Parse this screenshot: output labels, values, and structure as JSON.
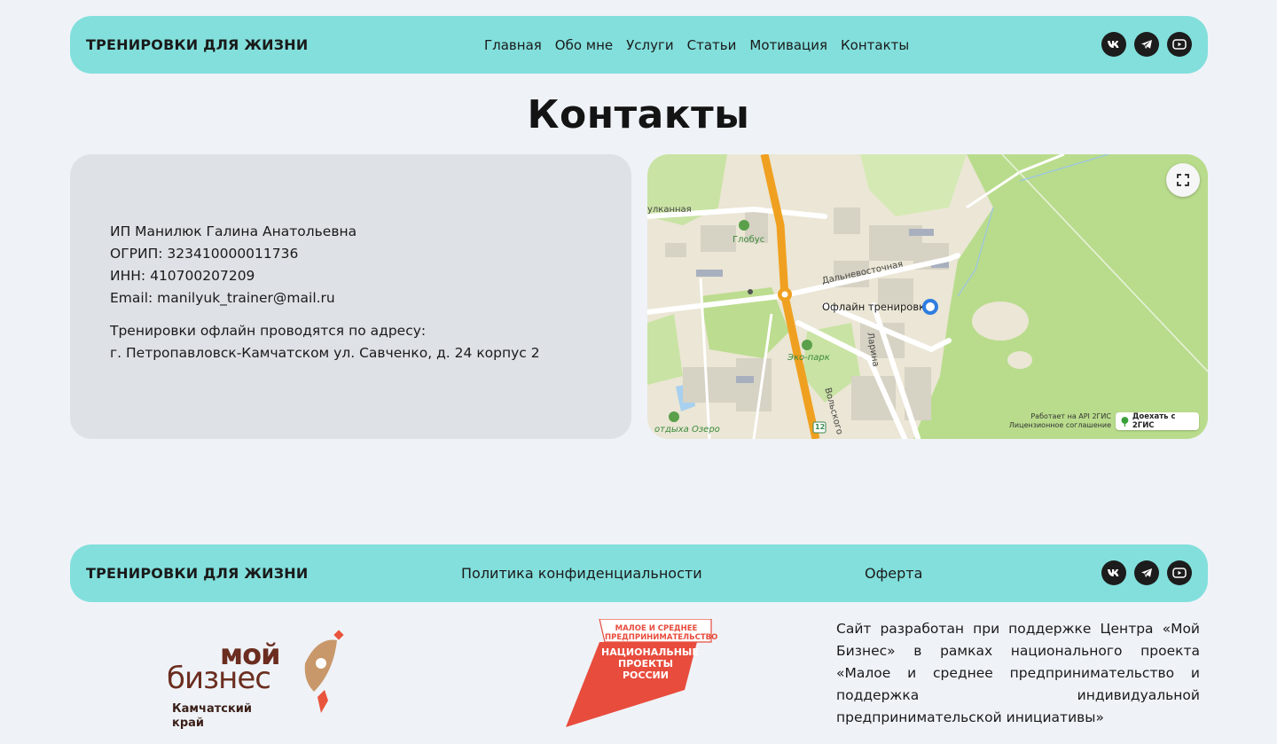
{
  "header": {
    "brand": "ТРЕНИРОВКИ ДЛЯ ЖИЗНИ",
    "nav": [
      "Главная",
      "Обо мне",
      "Услуги",
      "Статьи",
      "Мотивация",
      "Контакты"
    ],
    "socials": [
      "vk-icon",
      "telegram-icon",
      "youtube-icon"
    ]
  },
  "page": {
    "title": "Контакты"
  },
  "contacts": {
    "name": "ИП Манилюк Галина Анатольевна",
    "ogrip_label": "ОГРИП:",
    "ogrip_value": "323410000011736",
    "inn_label": "ИНН:",
    "inn_value": "410700207209",
    "email_label": "Email:",
    "email_value": "manilyuk_trainer@mail.ru",
    "address_title": "Тренировки офлайн проводятся по адресу:",
    "address": "г. Петропавловск-Камчатском ул. Савченко, д. 24 корпус 2"
  },
  "map": {
    "street_1": "улканная",
    "poi_1": "Глобус",
    "street_2": "Дальневосточная",
    "marker_label": "Офлайн тренировки",
    "street_3": "Ларина",
    "poi_2": "Эко-парк",
    "street_4": "Вольского",
    "poi_3": "отдыха Озеро",
    "road_number": "12",
    "attribution_1": "Работает на API 2ГИС",
    "attribution_2": "Лицензионное соглашение",
    "route_button": "Доехать с 2ГИС",
    "colors": {
      "park": "#b9dc8c",
      "road": "#f0a020",
      "water": "#a8d0ef",
      "marker": "#2f7de0"
    }
  },
  "footer": {
    "brand": "ТРЕНИРОВКИ ДЛЯ ЖИЗНИ",
    "privacy": "Политика конфиденциальности",
    "offer": "Оферта",
    "socials": [
      "vk-icon",
      "telegram-icon",
      "youtube-icon"
    ]
  },
  "partners": {
    "mb_moi": "мой",
    "mb_biz": "бизнес",
    "mb_region": "Камчатский край",
    "np_top": "МАЛОЕ И СРЕДНЕЕ ПРЕДПРИНИМАТЕЛЬСТВО",
    "np_line1": "НАЦИОНАЛЬНЫЕ",
    "np_line2": "ПРОЕКТЫ",
    "np_line3": "РОССИИ",
    "support_text": "Сайт разработан при поддержке Центра «Мой Бизнес» в рамках национального проекта «Малое и среднее предпринимательство и поддержка индивидуальной предпринимательской инициативы»"
  },
  "colors": {
    "accent_bar": "#82dfdc",
    "background": "#eff3f8",
    "card": "#dee1e6",
    "np_red": "#e84c3d",
    "mb_brown": "#6b2d1f"
  }
}
